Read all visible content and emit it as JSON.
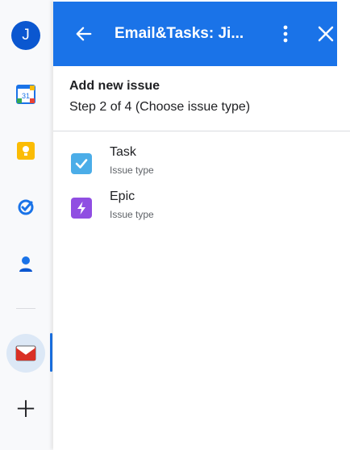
{
  "rail": {
    "avatar_letter": "J",
    "calendar_day": "31",
    "items": [
      "calendar-icon",
      "keep-icon",
      "tasks-icon",
      "contacts-icon",
      "mail-icon",
      "add-icon"
    ]
  },
  "panel": {
    "title": "Email&Tasks: Ji...",
    "accent_color": "#1a73e8"
  },
  "step": {
    "title": "Add new issue",
    "subtitle": "Step 2 of 4 (Choose issue type)"
  },
  "issue_types": [
    {
      "name": "Task",
      "sub": "Issue type",
      "icon": "task-checkbox-icon",
      "color": "#4bade8"
    },
    {
      "name": "Epic",
      "sub": "Issue type",
      "icon": "epic-lightning-icon",
      "color": "#904ee2"
    }
  ]
}
